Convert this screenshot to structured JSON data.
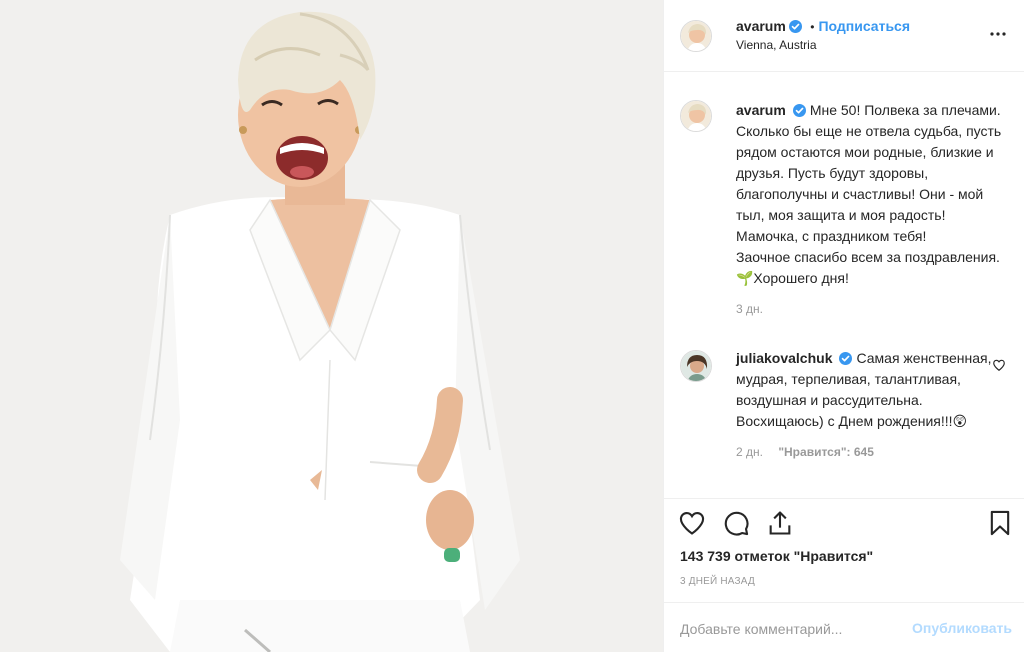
{
  "post": {
    "author": "avarum",
    "follow_label": "Подписаться",
    "separator": "•",
    "location": "Vienna, Austria",
    "photo_alt": "Photo by avarum"
  },
  "caption": {
    "username": "avarum",
    "text": "Мне 50! Полвека за плечами. Сколько бы еще не отвела судьба, пусть рядом остаются мои родные, близкие и друзья. Пусть будут здоровы, благополучны и счастливы! Они - мой тыл, моя защита и моя радость! Мамочка, с праздником тебя!\nЗаочное спасибо всем за поздравления.🌱Хорошего дня!",
    "time": "3 дн."
  },
  "comments": [
    {
      "username": "juliakovalchuk",
      "text": "Самая женственная, мудрая, терпеливая, талантливая, воздушная и рассудительна. Восхищаюсь) с Днем рождения!!!😲",
      "time": "2 дн.",
      "likes": "\"Нравится\": 645"
    }
  ],
  "actions": {
    "likes_count": "143 739 отметок \"Нравится\"",
    "date": "3 ДНЕЙ НАЗАД"
  },
  "comment_box": {
    "placeholder": "Добавьте комментарий...",
    "publish_label": "Опубликовать"
  },
  "colors": {
    "accent": "#3897f0",
    "muted": "#999999",
    "text": "#262626",
    "border": "#efefef",
    "verified": "#3897f0",
    "publish_disabled": "#b3dbff"
  },
  "icons": {
    "more": "more-horizontal-icon",
    "like": "heart-icon",
    "comment": "comment-bubble-icon",
    "share": "share-arrow-icon",
    "save": "bookmark-icon",
    "verified": "verified-badge-icon"
  }
}
